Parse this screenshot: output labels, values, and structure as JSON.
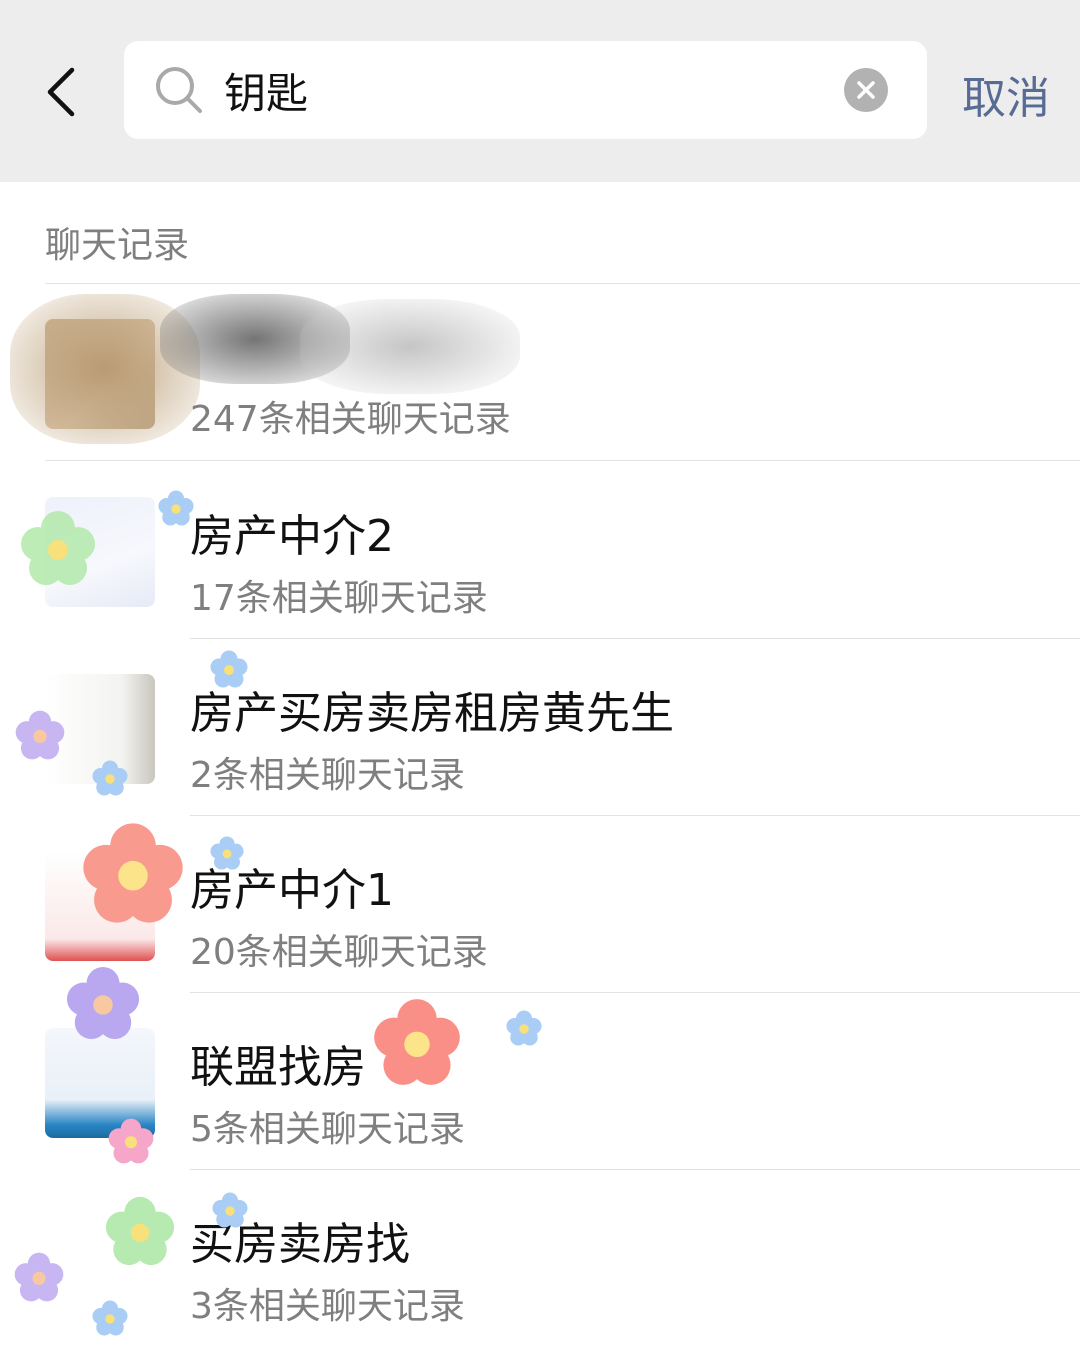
{
  "header": {
    "search_query": "钥匙",
    "cancel_label": "取消"
  },
  "section": {
    "title": "聊天记录"
  },
  "results": [
    {
      "name": "",
      "count": "247条相关聊天记录"
    },
    {
      "name": "房产中介2",
      "count": "17条相关聊天记录"
    },
    {
      "name": "房产买房卖房租房黄先生",
      "count": "2条相关聊天记录"
    },
    {
      "name": "房产中介1",
      "count": "20条相关聊天记录"
    },
    {
      "name": "联盟找房",
      "count": "5条相关聊天记录"
    },
    {
      "name": "买房卖房找",
      "count": "3条相关聊天记录"
    }
  ],
  "colors": {
    "topbar_bg": "#ededed",
    "cancel": "#576b95",
    "secondary_text": "#7f7f7f",
    "divider": "#e3e3e3"
  }
}
